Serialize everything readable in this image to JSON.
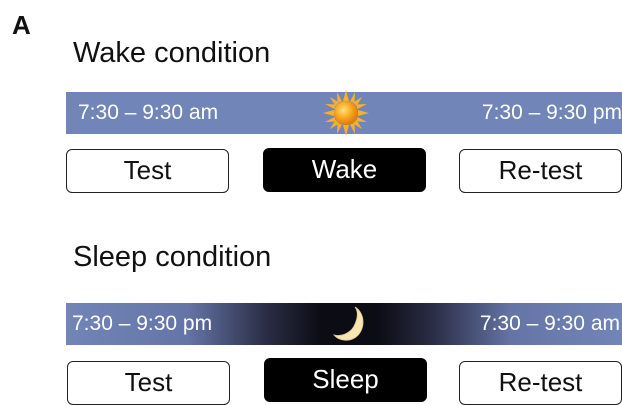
{
  "panel_label": "A",
  "wake": {
    "title": "Wake condition",
    "bar_left": "7:30 – 9:30 am",
    "bar_right": "7:30 – 9:30 pm",
    "icon": "sun-icon",
    "boxes": [
      "Test",
      "Wake",
      "Re-test"
    ]
  },
  "sleep": {
    "title": "Sleep condition",
    "bar_left": "7:30 – 9:30 pm",
    "bar_right": "7:30 – 9:30 am",
    "icon": "moon-icon",
    "boxes": [
      "Test",
      "Sleep",
      "Re-test"
    ]
  },
  "colors": {
    "bar_blue": "#7285b8",
    "night": "#0c0c14",
    "sun": "#f7a21b",
    "moon": "#f6e6b4",
    "active_box": "#000000"
  }
}
